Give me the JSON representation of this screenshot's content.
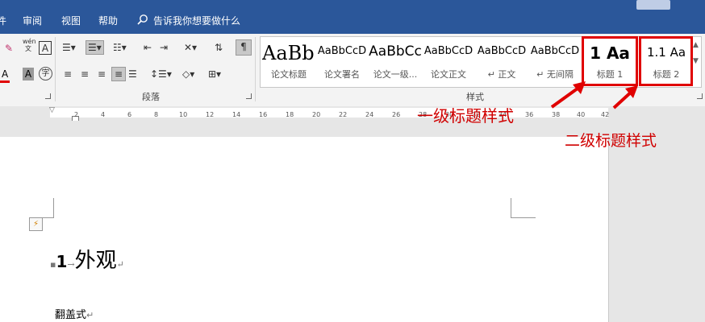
{
  "menu": {
    "items": [
      "件",
      "审阅",
      "视图",
      "帮助"
    ],
    "search_placeholder": "告诉我你想要做什么"
  },
  "ribbon": {
    "font_buttons": [
      "A",
      "A",
      "A"
    ],
    "font_wen": "wén\n文",
    "paragraph_label": "段落",
    "styles_label": "样式",
    "styles": [
      {
        "preview": "AaBbC",
        "name": "论文标题"
      },
      {
        "preview": "AaBbCcD",
        "name": "论文署名"
      },
      {
        "preview": "AaBbCc",
        "name": "论文一级..."
      },
      {
        "preview": "AaBbCcD",
        "name": "论文正文"
      },
      {
        "preview": "AaBbCcD",
        "name": "↵ 正文"
      },
      {
        "preview": "AaBbCcD",
        "name": "↵ 无间隔"
      },
      {
        "preview": "1  Aa",
        "name": "标题 1"
      },
      {
        "preview": "1.1  Aa",
        "name": "标题 2"
      }
    ]
  },
  "ruler": {
    "ticks": [
      "2",
      "4",
      "6",
      "8",
      "10",
      "12",
      "14",
      "16",
      "18",
      "20",
      "22",
      "24",
      "26",
      "28",
      "30",
      "32",
      "34",
      "36",
      "38",
      "40",
      "42"
    ]
  },
  "document": {
    "heading_num": "1",
    "heading_text": "外观",
    "body_text": "翻盖式"
  },
  "annotations": {
    "level1": "一级标题样式",
    "level2": "二级标题样式"
  },
  "colors": {
    "accent": "#2b579a",
    "annotation": "#e00000"
  }
}
